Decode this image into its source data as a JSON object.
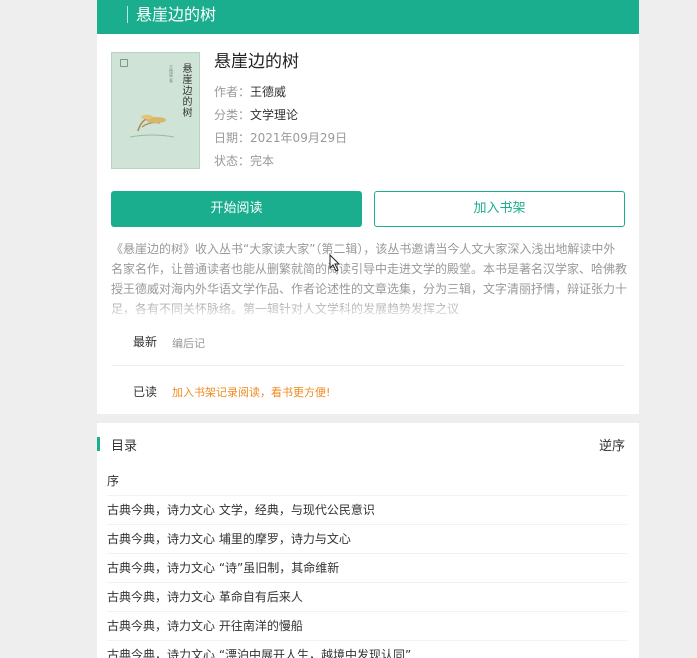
{
  "header": {
    "title": "悬崖边的树"
  },
  "book": {
    "cover_title": "悬崖边的树",
    "cover_author": "王德威 著",
    "cover_publisher": "",
    "title": "悬崖边的树",
    "author_label": "作者：",
    "author": "王德威",
    "category_label": "分类：",
    "category": "文学理论",
    "date_label": "日期：",
    "date": "2021年09月29日",
    "status_label": "状态：",
    "status": "完本"
  },
  "actions": {
    "read_label": "开始阅读",
    "shelf_label": "加入书架"
  },
  "description": "《悬崖边的树》收入丛书“大家读大家”（第二辑），该丛书邀请当今人文大家深入浅出地解读中外名家名作，让普通读者也能从删繁就简的阅读引导中走进文学的殿堂。本书是著名汉学家、哈佛教授王德威对海内外华语文学作品、作者论述性的文章选集，分为三辑，文字清丽抒情，辩证张力十足，各有不同关怀脉络。第一辑针对人文学科的发展趋势发挥之议",
  "latest": {
    "label": "最新",
    "value": "编后记"
  },
  "read": {
    "label": "已读",
    "value": "加入书架记录阅读，看书更方便!"
  },
  "catalog": {
    "title": "目录",
    "order_label": "逆序",
    "chapters": [
      "序",
      "古典今典，诗力文心 文学，经典，与现代公民意识",
      "古典今典，诗力文心 埔里的摩罗，诗力与文心",
      "古典今典，诗力文心 “诗”虽旧制，其命维新",
      "古典今典，诗力文心 革命自有后来人",
      "古典今典，诗力文心 开往南洋的慢船",
      "古典今典，诗力文心 “漂泊中展开人生，越境中发现认同”"
    ]
  },
  "colors": {
    "accent": "#1aae8e",
    "notice": "#f08b1f"
  }
}
